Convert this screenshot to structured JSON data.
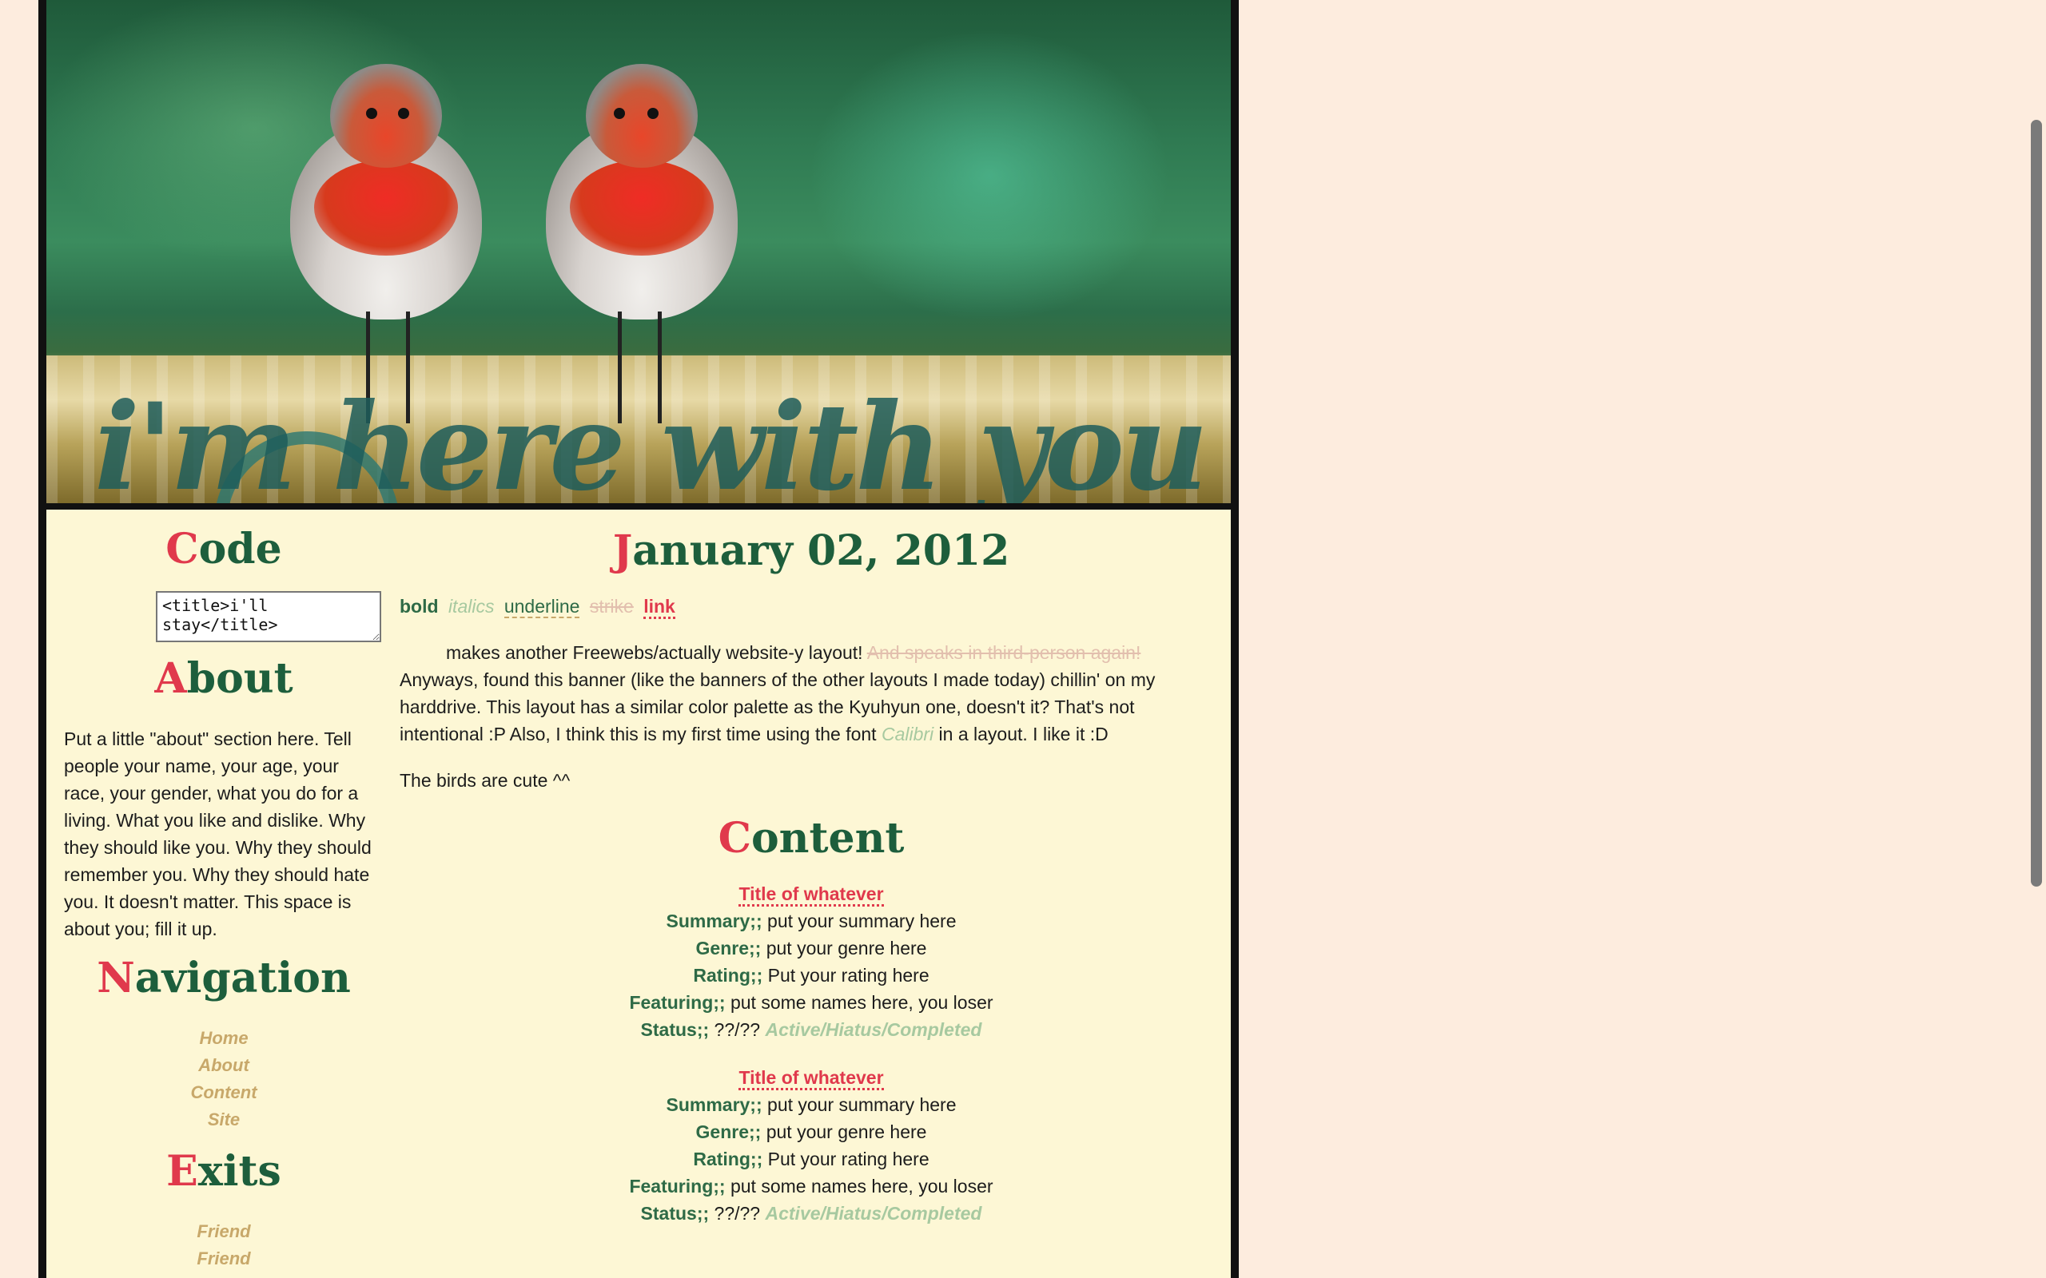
{
  "banner": {
    "title": "i'm here with you"
  },
  "sidebar": {
    "code": {
      "heading_first": "C",
      "heading_rest": "ode",
      "snippet": "<title>i'll stay</title>"
    },
    "about": {
      "heading_first": "A",
      "heading_rest": "bout",
      "text": "Put a little \"about\" section here. Tell people your name, your age, your race, your gender, what you do for a living. What you like and dislike. Why they should like you. Why they should remember you. Why they should hate you. It doesn't matter. This space is about you; fill it up."
    },
    "navigation": {
      "heading_first": "N",
      "heading_rest": "avigation",
      "items": [
        "Home",
        "About",
        "Content",
        "Site"
      ]
    },
    "exits": {
      "heading_first": "E",
      "heading_rest": "xits",
      "items": [
        "Friend",
        "Friend"
      ]
    }
  },
  "post": {
    "date_first": "J",
    "date_rest": "anuary 02, 2012",
    "format": {
      "bold": "bold",
      "italics": "italics",
      "underline": "underline",
      "strike": "strike",
      "link": "link"
    },
    "body_part1": "makes another Freewebs/actually website-y layout! ",
    "body_struck": "And speaks in third-person again!",
    "body_part2": " Anyways, found this banner (like the banners of the other layouts I made today) chillin' on my harddrive. This layout has a similar color palette as the Kyuhyun one, doesn't it? That's not intentional :P Also, I think this is my first time using the font ",
    "body_font": "Calibri",
    "body_part3": " in a layout. I like it :D",
    "closing": "The birds are cute ^^"
  },
  "content": {
    "heading_first": "C",
    "heading_rest": "ontent",
    "entries": [
      {
        "title": "Title of whatever",
        "summary_label": "Summary;;",
        "summary": " put your summary here",
        "genre_label": "Genre;;",
        "genre": " put your genre here",
        "rating_label": "Rating;;",
        "rating": " Put your rating here",
        "featuring_label": "Featuring;;",
        "featuring": " put some names here, you loser",
        "status_label": "Status;;",
        "status_count": " ??/?? ",
        "status_value": "Active/Hiatus/Completed"
      },
      {
        "title": "Title of whatever",
        "summary_label": "Summary;;",
        "summary": " put your summary here",
        "genre_label": "Genre;;",
        "genre": " put your genre here",
        "rating_label": "Rating;;",
        "rating": " Put your rating here",
        "featuring_label": "Featuring;;",
        "featuring": " put some names here, you loser",
        "status_label": "Status;;",
        "status_count": " ??/?? ",
        "status_value": "Active/Hiatus/Completed"
      }
    ]
  },
  "colors": {
    "page_bg": "#fdecde",
    "panel_bg": "#fdf7d5",
    "heading": "#1d5e3c",
    "accent": "#e0394c",
    "muted_gold": "#c8a86a",
    "pale_green": "#a7c9a0"
  }
}
